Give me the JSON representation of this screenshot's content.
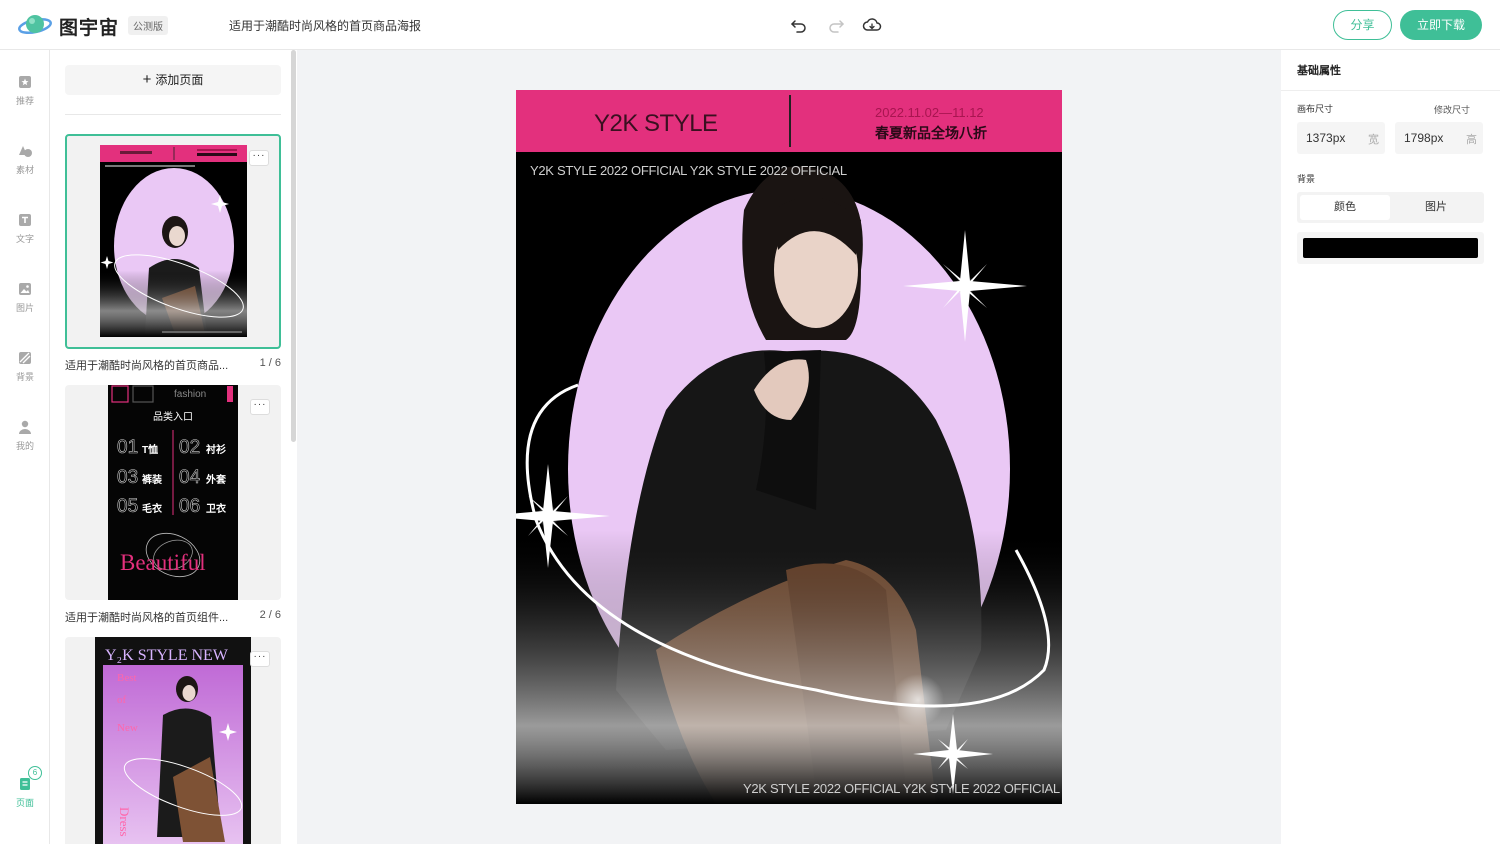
{
  "app": {
    "brand": "图宇宙",
    "beta_badge": "公测版",
    "doc_title": "适用于潮酷时尚风格的首页商品海报",
    "share_label": "分享",
    "download_label": "立即下载",
    "accent_color": "#3fbf97"
  },
  "sidebar": {
    "items": [
      {
        "label": "推荐",
        "icon": "recommend-icon"
      },
      {
        "label": "素材",
        "icon": "shapes-icon"
      },
      {
        "label": "文字",
        "icon": "text-icon"
      },
      {
        "label": "图片",
        "icon": "image-icon"
      },
      {
        "label": "背景",
        "icon": "background-icon"
      },
      {
        "label": "我的",
        "icon": "user-icon"
      }
    ],
    "pages": {
      "label": "页面",
      "count": "6",
      "icon": "pages-icon"
    }
  },
  "pages_panel": {
    "add_page_label": "添加页面",
    "pages": [
      {
        "caption": "适用于潮酷时尚风格的首页商品...",
        "index": "1 / 6"
      },
      {
        "caption": "适用于潮酷时尚风格的首页组件...",
        "index": "2 / 6"
      },
      {
        "caption": "",
        "index": ""
      }
    ],
    "thumb2": {
      "fashion": "fashion",
      "heading": "品类入口",
      "items": [
        {
          "num": "01",
          "name": "T恤"
        },
        {
          "num": "02",
          "name": "衬衫"
        },
        {
          "num": "03",
          "name": "裤装"
        },
        {
          "num": "04",
          "name": "外套"
        },
        {
          "num": "05",
          "name": "毛衣"
        },
        {
          "num": "06",
          "name": "卫衣"
        }
      ],
      "script": "Beautiful"
    },
    "thumb3": {
      "title": "Y₂K STYLE NEW",
      "lines": [
        "Best",
        "of",
        "New"
      ],
      "dress": "Dress"
    }
  },
  "poster": {
    "brand": "Y2K STYLE",
    "date": "2022.11.02—11.12",
    "sale": "春夏新品全场八折",
    "strip_top": "Y2K STYLE 2022 OFFICIAL  Y2K STYLE 2022 OFFICIAL",
    "strip_bottom": "Y2K STYLE 2022 OFFICIAL  Y2K STYLE 2022 OFFICIAL",
    "header_color": "#e3307d",
    "ellipse_color": "#eac8f5"
  },
  "properties": {
    "heading": "基础属性",
    "canvas_size_label": "画布尺寸",
    "resize_link": "修改尺寸",
    "width_value": "1373px",
    "width_unit": "宽",
    "height_value": "1798px",
    "height_unit": "高",
    "background_label": "背景",
    "bg_tabs": [
      "颜色",
      "图片"
    ],
    "bg_color": "#000000"
  }
}
